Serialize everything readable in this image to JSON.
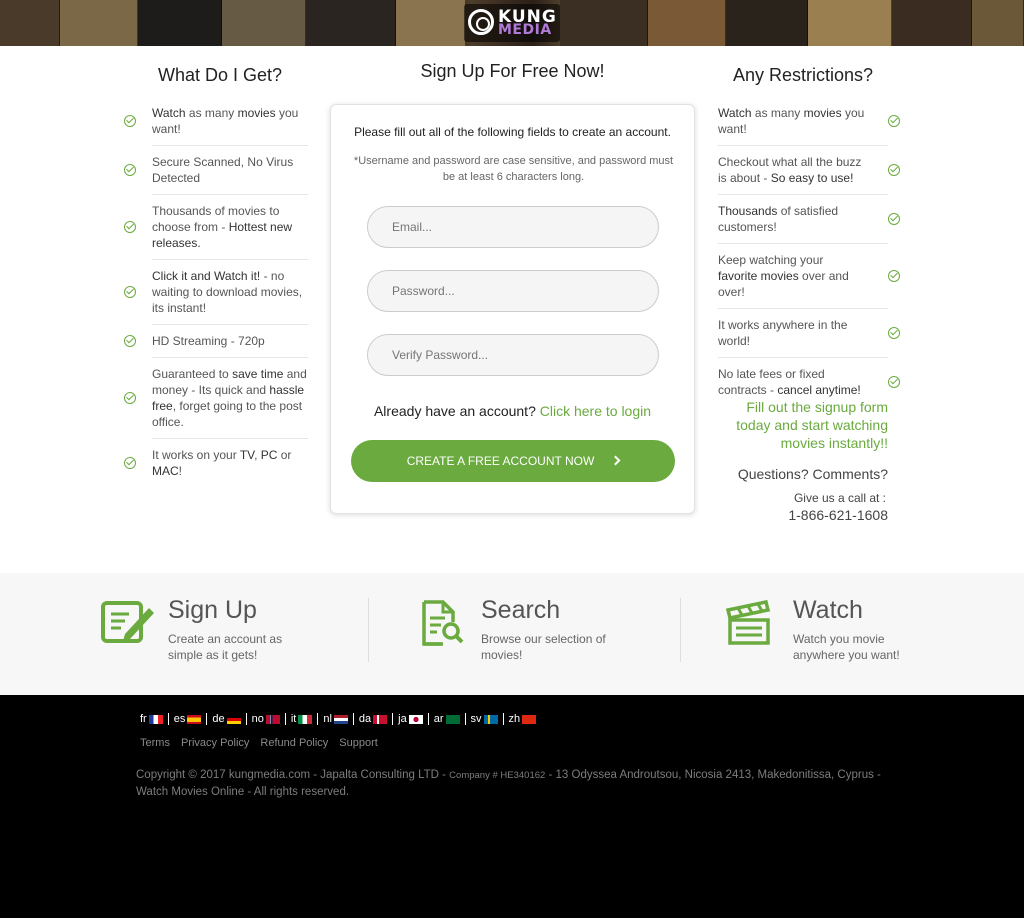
{
  "header": {
    "logo_line1": "KUNG",
    "logo_line2": "MEDIA"
  },
  "left": {
    "title": "What Do I Get?",
    "items": [
      {
        "parts": [
          {
            "t": "Watch",
            "b": true
          },
          {
            "t": " as many ",
            "b": false
          },
          {
            "t": "movies",
            "b": true
          },
          {
            "t": " you want!",
            "b": false
          }
        ]
      },
      {
        "parts": [
          {
            "t": "Secure Scanned, No Virus Detected",
            "b": false
          }
        ]
      },
      {
        "parts": [
          {
            "t": "Thousands of movies to choose from - ",
            "b": false
          },
          {
            "t": "Hottest new releases.",
            "b": true
          }
        ]
      },
      {
        "parts": [
          {
            "t": "Click it and Watch it!",
            "b": true
          },
          {
            "t": " - no waiting to download movies, its instant!",
            "b": false
          }
        ]
      },
      {
        "parts": [
          {
            "t": "HD Streaming - 720p",
            "b": false
          }
        ]
      },
      {
        "parts": [
          {
            "t": "Guaranteed to ",
            "b": false
          },
          {
            "t": "save time",
            "b": true
          },
          {
            "t": " and money - Its quick and ",
            "b": false
          },
          {
            "t": "hassle free",
            "b": true
          },
          {
            "t": ", forget going to the post office.",
            "b": false
          }
        ]
      },
      {
        "parts": [
          {
            "t": "It works on your ",
            "b": false
          },
          {
            "t": "TV",
            "b": true
          },
          {
            "t": ", ",
            "b": false
          },
          {
            "t": "PC",
            "b": true
          },
          {
            "t": " or ",
            "b": false
          },
          {
            "t": "MAC",
            "b": true
          },
          {
            "t": "!",
            "b": false
          }
        ]
      }
    ]
  },
  "form": {
    "title": "Sign Up For Free Now!",
    "intro": "Please fill out all of the following fields to create an account.",
    "note": "*Username and password are case sensitive, and password must be at least 6 characters long.",
    "email_placeholder": "Email...",
    "password_placeholder": "Password...",
    "verify_placeholder": "Verify Password...",
    "login_prompt": "Already have an account?",
    "login_link": "Click here to login",
    "cta_label": "CREATE A FREE ACCOUNT NOW"
  },
  "right": {
    "title": "Any Restrictions?",
    "items": [
      {
        "parts": [
          {
            "t": "Watch",
            "b": true
          },
          {
            "t": " as many ",
            "b": false
          },
          {
            "t": "movies",
            "b": true
          },
          {
            "t": " you want!",
            "b": false
          }
        ]
      },
      {
        "parts": [
          {
            "t": "Checkout what all the buzz is about - ",
            "b": false
          },
          {
            "t": "So easy to use!",
            "b": true
          }
        ]
      },
      {
        "parts": [
          {
            "t": "Thousands",
            "b": true
          },
          {
            "t": " of satisfied customers!",
            "b": false
          }
        ]
      },
      {
        "parts": [
          {
            "t": "Keep watching your ",
            "b": false
          },
          {
            "t": "favorite movies",
            "b": true
          },
          {
            "t": " over and over!",
            "b": false
          }
        ]
      },
      {
        "parts": [
          {
            "t": "It works anywhere in the world!",
            "b": false
          }
        ]
      },
      {
        "parts": [
          {
            "t": "No late fees or fixed contracts - ",
            "b": false
          },
          {
            "t": "cancel anytime!",
            "b": true
          }
        ]
      }
    ],
    "promo": "Fill out the signup form today and start watching movies instantly!!",
    "questions": "Questions? Comments?",
    "call_us": "Give us a call at :",
    "phone": "1-866-621-1608"
  },
  "features": [
    {
      "title": "Sign Up",
      "desc": "Create an account as simple as it gets!",
      "icon": "sign-up-icon"
    },
    {
      "title": "Search",
      "desc": "Browse our selection of movies!",
      "icon": "search-doc-icon"
    },
    {
      "title": "Watch",
      "desc": "Watch you movie anywhere you want!",
      "icon": "clapperboard-icon"
    }
  ],
  "footer": {
    "languages": [
      {
        "code": "fr",
        "flag": "flag-fr-icon"
      },
      {
        "code": "es",
        "flag": "flag-es-icon"
      },
      {
        "code": "de",
        "flag": "flag-de-icon"
      },
      {
        "code": "no",
        "flag": "flag-no-icon"
      },
      {
        "code": "it",
        "flag": "flag-it-icon"
      },
      {
        "code": "nl",
        "flag": "flag-nl-icon"
      },
      {
        "code": "da",
        "flag": "flag-dk-icon"
      },
      {
        "code": "ja",
        "flag": "flag-jp-icon"
      },
      {
        "code": "ar",
        "flag": "flag-sa-icon"
      },
      {
        "code": "sv",
        "flag": "flag-se-icon"
      },
      {
        "code": "zh",
        "flag": "flag-cn-icon"
      }
    ],
    "links": [
      "Terms",
      "Privacy Policy",
      "Refund Policy",
      "Support"
    ],
    "copyright_a": "Copyright © 2017 kungmedia.com - Japalta Consulting LTD - ",
    "company_no": "Company # HE340162",
    "copyright_b": " - 13 Odyssea Androutsou, Nicosia 2413, Makedonitissa, Cyprus - Watch Movies Online - All rights reserved."
  },
  "colors": {
    "accent": "#6aaa3e",
    "footer_bg": "#000000",
    "band_bg": "#f7f7f7"
  }
}
